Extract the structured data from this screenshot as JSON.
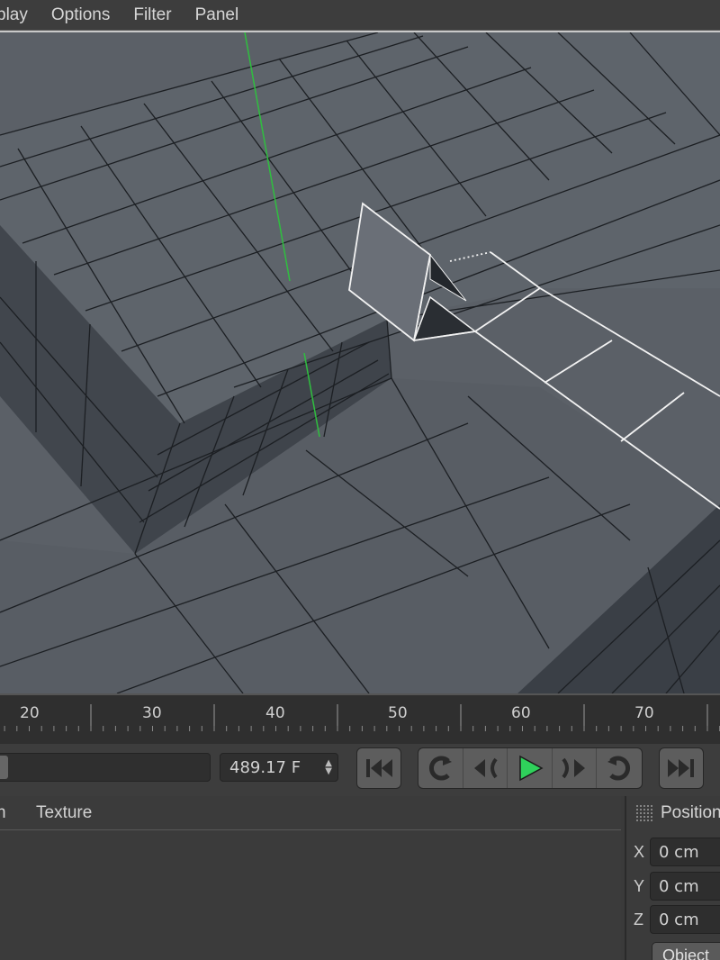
{
  "menu": {
    "items": [
      "play",
      "Options",
      "Filter",
      "Panel"
    ]
  },
  "timeline": {
    "ruler_labels": [
      "20",
      "30",
      "40",
      "50",
      "60",
      "70"
    ]
  },
  "transport": {
    "frame_value": "489.17 F",
    "play_color": "#2fd15b"
  },
  "attributes_panel": {
    "tabs": [
      "n",
      "Texture"
    ]
  },
  "coordinates_panel": {
    "title": "Position",
    "rows": [
      {
        "axis": "X",
        "value": "0 cm"
      },
      {
        "axis": "Y",
        "value": "0 cm"
      },
      {
        "axis": "Z",
        "value": "0 cm"
      }
    ],
    "mode_button": "Object"
  },
  "icons": [
    "goto-start-icon",
    "prev-key-icon",
    "prev-frame-icon",
    "play-icon",
    "next-frame-icon",
    "next-key-icon",
    "goto-end-icon",
    "grip-icon"
  ]
}
